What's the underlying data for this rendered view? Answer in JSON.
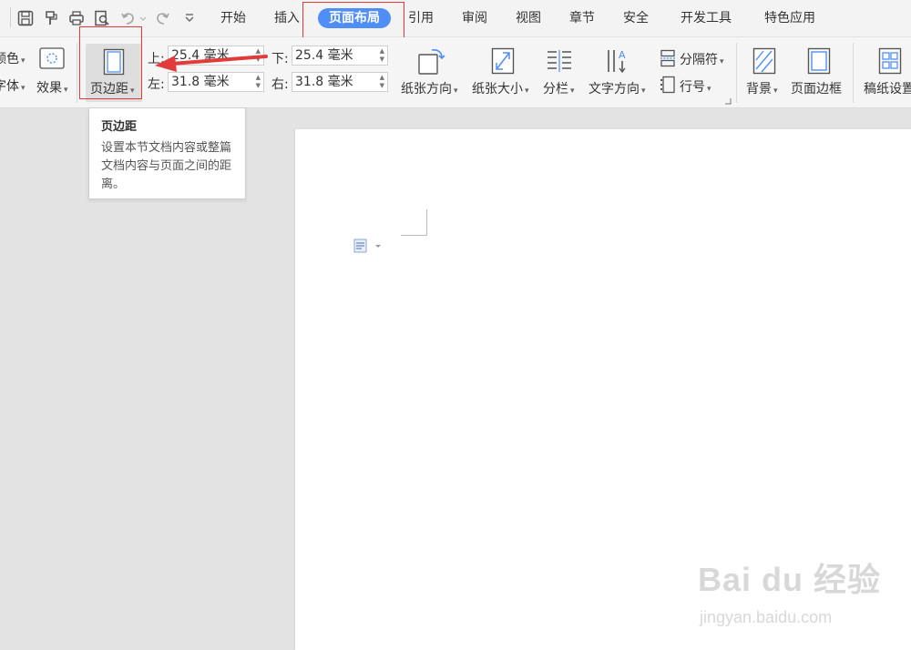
{
  "tabs": [
    "开始",
    "插入",
    "页面布局",
    "引用",
    "审阅",
    "视图",
    "章节",
    "安全",
    "开发工具",
    "特色应用"
  ],
  "active_tab": "页面布局",
  "ribbon": {
    "color_label": "颜色",
    "font_label": "字体",
    "effect_label": "效果",
    "margin_label": "页边距",
    "margins": {
      "top_label": "上:",
      "top_value": "25.4 毫米",
      "bottom_label": "下:",
      "bottom_value": "25.4 毫米",
      "left_label": "左:",
      "left_value": "31.8 毫米",
      "right_label": "右:",
      "right_value": "31.8 毫米"
    },
    "orientation_label": "纸张方向",
    "size_label": "纸张大小",
    "columns_label": "分栏",
    "text_direction_label": "文字方向",
    "break_label": "分隔符",
    "line_number_label": "行号",
    "background_label": "背景",
    "page_border_label": "页面边框",
    "draft_paper_label": "稿纸设置"
  },
  "tooltip": {
    "title": "页边距",
    "body": "设置本节文档内容或整篇文档内容与页面之间的距离。"
  },
  "watermark": {
    "logo_text": "Bai du 经验",
    "url": "jingyan.baidu.com"
  },
  "colors": {
    "accent": "#4f8ef7",
    "highlight_border": "#e23b3b",
    "arrow": "#e23b3b"
  }
}
